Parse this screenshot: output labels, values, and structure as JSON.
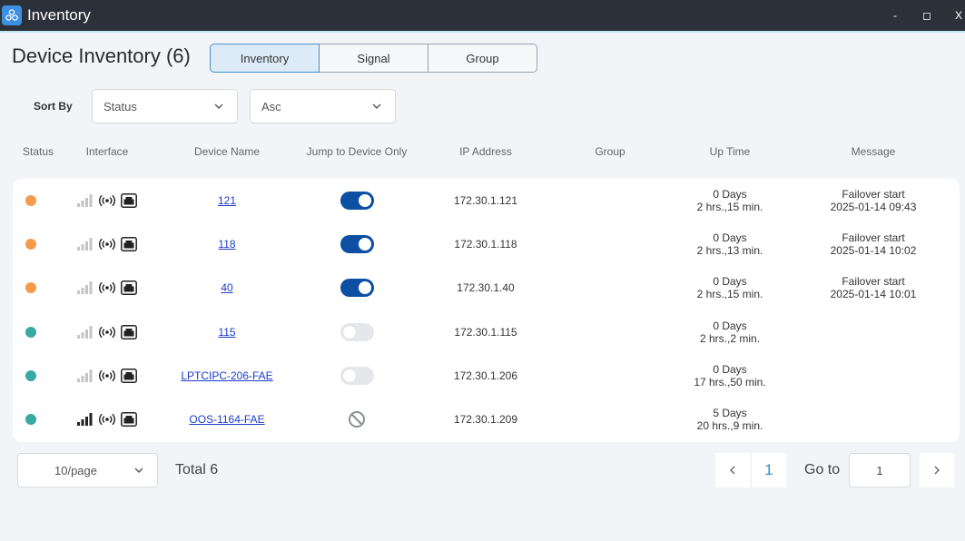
{
  "window": {
    "title": "Inventory",
    "minimize": "-",
    "maximize": "◻",
    "close": "X"
  },
  "header": {
    "title": "Device Inventory (6)"
  },
  "tabs": [
    {
      "label": "Inventory",
      "active": true
    },
    {
      "label": "Signal"
    },
    {
      "label": "Group"
    }
  ],
  "sort": {
    "label": "Sort By",
    "field": "Status",
    "order": "Asc"
  },
  "columns": {
    "status": "Status",
    "interface": "Interface",
    "device_name": "Device Name",
    "jump": "Jump to Device Only",
    "ip": "IP Address",
    "group": "Group",
    "uptime": "Up Time",
    "message": "Message"
  },
  "colors": {
    "orange": "#f59a4a",
    "teal": "#3aa8a3",
    "accent": "#0c4fa3"
  },
  "rows": [
    {
      "status": "orange",
      "signal_level": 0,
      "device_name": "121",
      "jump": "on",
      "ip": "172.30.1.121",
      "group": "",
      "uptime_days": "0 Days",
      "uptime_time": "2 hrs.,15 min.",
      "message_title": "Failover start",
      "message_time": "2025-01-14 09:43"
    },
    {
      "status": "orange",
      "signal_level": 0,
      "device_name": "118",
      "jump": "on",
      "ip": "172.30.1.118",
      "group": "",
      "uptime_days": "0 Days",
      "uptime_time": "2 hrs.,13 min.",
      "message_title": "Failover start",
      "message_time": "2025-01-14 10:02"
    },
    {
      "status": "orange",
      "signal_level": 0,
      "device_name": "40",
      "jump": "on",
      "ip": "172.30.1.40",
      "group": "",
      "uptime_days": "0 Days",
      "uptime_time": "2 hrs.,15 min.",
      "message_title": "Failover start",
      "message_time": "2025-01-14 10:01"
    },
    {
      "status": "teal",
      "signal_level": 0,
      "device_name": "115",
      "jump": "off",
      "ip": "172.30.1.115",
      "group": "",
      "uptime_days": "0 Days",
      "uptime_time": "2 hrs.,2 min.",
      "message_title": "",
      "message_time": ""
    },
    {
      "status": "teal",
      "signal_level": 0,
      "device_name": "LPTCIPC-206-FAE",
      "jump": "off",
      "ip": "172.30.1.206",
      "group": "",
      "uptime_days": "0 Days",
      "uptime_time": "17 hrs.,50 min.",
      "message_title": "",
      "message_time": ""
    },
    {
      "status": "teal",
      "signal_level": 4,
      "device_name": "OOS-1164-FAE",
      "jump": "disabled",
      "ip": "172.30.1.209",
      "group": "",
      "uptime_days": "5 Days",
      "uptime_time": "20 hrs.,9 min.",
      "message_title": "",
      "message_time": ""
    }
  ],
  "footer": {
    "page_size": "10/page",
    "total": "Total 6",
    "current_page": "1",
    "goto_label": "Go to",
    "goto_value": "1"
  }
}
